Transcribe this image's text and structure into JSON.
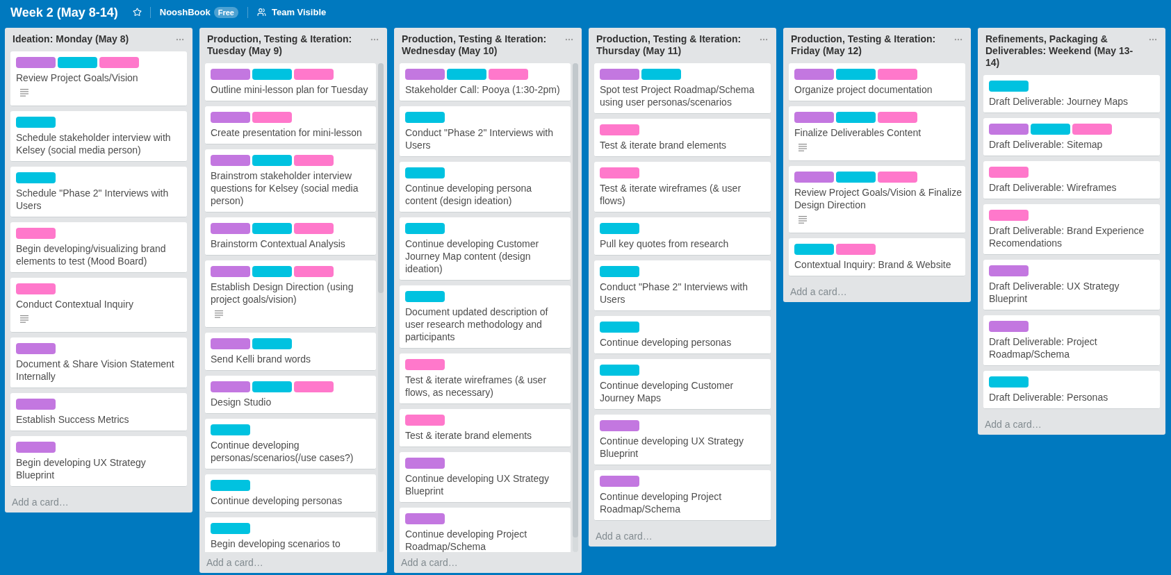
{
  "board": {
    "title": "Week 2 (May 8-14)",
    "starred": false,
    "team": "NooshBook",
    "plan_badge": "Free",
    "visibility": "Team Visible"
  },
  "lists": [
    {
      "kind": "plain",
      "title": "Ideation: Monday (May 8)",
      "add_card": "Add a card…",
      "cards": [
        {
          "labels": [
            {
              "color": "#c377e0"
            },
            {
              "color": "#00c2e0"
            },
            {
              "color": "#ff78cb"
            }
          ],
          "title": "Review Project Goals/Vision",
          "description": true
        },
        {
          "labels": [
            {
              "color": "#00c2e0"
            }
          ],
          "title": "Schedule stakeholder interview with\nKelsey (social media person)",
          "description": false
        },
        {
          "labels": [
            {
              "color": "#00c2e0"
            }
          ],
          "title": "Schedule \"Phase 2\" Interviews with\nUsers",
          "description": false
        },
        {
          "labels": [
            {
              "color": "#ff78cb"
            }
          ],
          "title": "Begin developing/visualizing brand\nelements to test (Mood Board)",
          "description": false
        },
        {
          "labels": [
            {
              "color": "#ff78cb"
            }
          ],
          "title": "Conduct Contextual Inquiry",
          "description": true
        },
        {
          "labels": [
            {
              "color": "#c377e0"
            }
          ],
          "title": "Document & Share Vision Statement\nInternally",
          "description": false
        },
        {
          "labels": [
            {
              "color": "#c377e0"
            }
          ],
          "title": "Establish Success Metrics",
          "description": false
        },
        {
          "labels": [
            {
              "color": "#c377e0"
            }
          ],
          "title": "Begin developing UX Strategy\nBlueprint",
          "description": false
        }
      ]
    },
    {
      "kind": "scrollable",
      "title": "Production, Testing & Iteration:\nTuesday (May 9)",
      "add_card": "Add a card…",
      "cards": [
        {
          "labels": [
            {
              "color": "#c377e0"
            },
            {
              "color": "#00c2e0"
            },
            {
              "color": "#ff78cb"
            }
          ],
          "title": "Outline mini-lesson plan for Tuesday",
          "description": false
        },
        {
          "labels": [
            {
              "color": "#c377e0"
            },
            {
              "color": "#ff78cb"
            }
          ],
          "title": "Create presentation for mini-lesson",
          "description": false
        },
        {
          "labels": [
            {
              "color": "#c377e0"
            },
            {
              "color": "#00c2e0"
            },
            {
              "color": "#ff78cb"
            }
          ],
          "title": "Brainstrom stakeholder interview\nquestions for Kelsey (social media\nperson)",
          "description": false
        },
        {
          "labels": [
            {
              "color": "#c377e0"
            },
            {
              "color": "#00c2e0"
            },
            {
              "color": "#ff78cb"
            }
          ],
          "title": "Brainstorm Contextual Analysis",
          "description": false
        },
        {
          "labels": [
            {
              "color": "#c377e0"
            },
            {
              "color": "#00c2e0"
            },
            {
              "color": "#ff78cb"
            }
          ],
          "title": "Establish Design Direction (using\nproject goals/vision)",
          "description": true
        },
        {
          "labels": [
            {
              "color": "#c377e0"
            },
            {
              "color": "#00c2e0"
            }
          ],
          "title": "Send Kelli brand words",
          "description": false
        },
        {
          "labels": [
            {
              "color": "#c377e0"
            },
            {
              "color": "#00c2e0"
            },
            {
              "color": "#ff78cb"
            }
          ],
          "title": "Design Studio",
          "description": false
        },
        {
          "labels": [
            {
              "color": "#00c2e0"
            }
          ],
          "title": "Continue developing\npersonas/scenarios(/use cases?)",
          "description": false
        },
        {
          "labels": [
            {
              "color": "#00c2e0"
            }
          ],
          "title": "Continue developing personas",
          "description": false
        },
        {
          "labels": [
            {
              "color": "#00c2e0"
            }
          ],
          "title": "Begin developing scenarios to",
          "description": false
        }
      ]
    },
    {
      "kind": "overflowing",
      "title": "Production, Testing & Iteration:\nWednesday (May 10)",
      "add_card": "Add a card…",
      "cards": [
        {
          "labels": [
            {
              "color": "#c377e0"
            },
            {
              "color": "#00c2e0"
            },
            {
              "color": "#ff78cb"
            }
          ],
          "title": "Stakeholder Call: Pooya (1:30-2pm)",
          "description": false
        },
        {
          "labels": [
            {
              "color": "#00c2e0"
            }
          ],
          "title": "Conduct \"Phase 2\" Interviews with\nUsers",
          "description": false
        },
        {
          "labels": [
            {
              "color": "#00c2e0"
            }
          ],
          "title": "Continue developing persona\ncontent (design ideation)",
          "description": false
        },
        {
          "labels": [
            {
              "color": "#00c2e0"
            }
          ],
          "title": "Continue developing Customer\nJourney Map content (design\nideation)",
          "description": false
        },
        {
          "labels": [
            {
              "color": "#00c2e0"
            }
          ],
          "title": "Document updated description of\nuser research methodology and\nparticipants",
          "description": false
        },
        {
          "labels": [
            {
              "color": "#ff78cb"
            }
          ],
          "title": "Test & iterate wireframes (& user\nflows, as necessary)",
          "description": false
        },
        {
          "labels": [
            {
              "color": "#ff78cb"
            }
          ],
          "title": "Test & iterate brand elements",
          "description": false
        },
        {
          "labels": [
            {
              "color": "#c377e0"
            }
          ],
          "title": "Continue developing UX Strategy\nBlueprint",
          "description": false
        },
        {
          "labels": [
            {
              "color": "#c377e0"
            }
          ],
          "title": "Continue developing Project\nRoadmap/Schema",
          "description": false
        }
      ]
    },
    {
      "kind": "plain",
      "title": "Production, Testing & Iteration:\nThursday (May 11)",
      "add_card": "Add a card…",
      "cards": [
        {
          "labels": [
            {
              "color": "#c377e0"
            },
            {
              "color": "#00c2e0"
            }
          ],
          "title": "Spot test Project Roadmap/Schema\nusing user personas/scenarios",
          "description": false
        },
        {
          "labels": [
            {
              "color": "#ff78cb"
            }
          ],
          "title": "Test & iterate brand elements",
          "description": false
        },
        {
          "labels": [
            {
              "color": "#ff78cb"
            }
          ],
          "title": "Test & iterate wireframes (& user\nflows)",
          "description": false
        },
        {
          "labels": [
            {
              "color": "#00c2e0"
            }
          ],
          "title": "Pull key quotes from research",
          "description": false
        },
        {
          "labels": [
            {
              "color": "#00c2e0"
            }
          ],
          "title": "Conduct \"Phase 2\" Interviews with\nUsers",
          "description": false
        },
        {
          "labels": [
            {
              "color": "#00c2e0"
            }
          ],
          "title": "Continue developing personas",
          "description": false
        },
        {
          "labels": [
            {
              "color": "#00c2e0"
            }
          ],
          "title": "Continue developing Customer\nJourney Maps",
          "description": false
        },
        {
          "labels": [
            {
              "color": "#c377e0"
            }
          ],
          "title": "Continue developing UX Strategy\nBlueprint",
          "description": false
        },
        {
          "labels": [
            {
              "color": "#c377e0"
            }
          ],
          "title": "Continue developing Project\nRoadmap/Schema",
          "description": false
        }
      ]
    },
    {
      "kind": "plain",
      "title": "Production, Testing & Iteration:\nFriday (May 12)",
      "add_card": "Add a card…",
      "cards": [
        {
          "labels": [
            {
              "color": "#c377e0"
            },
            {
              "color": "#00c2e0"
            },
            {
              "color": "#ff78cb"
            }
          ],
          "title": "Organize project documentation",
          "description": false
        },
        {
          "labels": [
            {
              "color": "#c377e0"
            },
            {
              "color": "#00c2e0"
            },
            {
              "color": "#ff78cb"
            }
          ],
          "title": "Finalize Deliverables Content",
          "description": true
        },
        {
          "labels": [
            {
              "color": "#c377e0"
            },
            {
              "color": "#00c2e0"
            },
            {
              "color": "#ff78cb"
            }
          ],
          "title": "Review Project Goals/Vision & Finalize\nDesign Direction",
          "description": true
        },
        {
          "labels": [
            {
              "color": "#00c2e0"
            },
            {
              "color": "#ff78cb"
            }
          ],
          "title": "Contextual Inquiry: Brand & Website",
          "description": false
        }
      ]
    },
    {
      "kind": "plain",
      "title": "Refinements, Packaging &\nDeliverables: Weekend (May 13-\n14)",
      "add_card": "Add a card…",
      "cards": [
        {
          "labels": [
            {
              "color": "#00c2e0"
            }
          ],
          "title": "Draft Deliverable: Journey Maps",
          "description": false
        },
        {
          "labels": [
            {
              "color": "#c377e0"
            },
            {
              "color": "#00c2e0"
            },
            {
              "color": "#ff78cb"
            }
          ],
          "title": "Draft Deliverable: Sitemap",
          "description": false
        },
        {
          "labels": [
            {
              "color": "#ff78cb"
            }
          ],
          "title": "Draft Deliverable: Wireframes",
          "description": false
        },
        {
          "labels": [
            {
              "color": "#ff78cb"
            }
          ],
          "title": "Draft Deliverable: Brand Experience\nRecomendations",
          "description": false
        },
        {
          "labels": [
            {
              "color": "#c377e0"
            }
          ],
          "title": "Draft Deliverable: UX Strategy\nBlueprint",
          "description": false
        },
        {
          "labels": [
            {
              "color": "#c377e0"
            }
          ],
          "title": "Draft Deliverable: Project\nRoadmap/Schema",
          "description": false
        },
        {
          "labels": [
            {
              "color": "#00c2e0"
            }
          ],
          "title": "Draft Deliverable: Personas",
          "description": false
        }
      ]
    }
  ]
}
